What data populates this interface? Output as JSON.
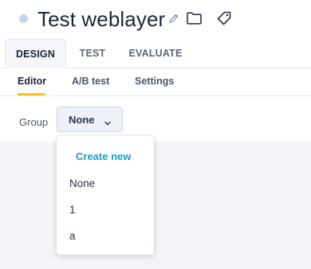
{
  "header": {
    "title": "Test weblayer",
    "status_color": "#c9d3ea",
    "icons": [
      "pencil-icon",
      "folder-icon",
      "tag-icon"
    ]
  },
  "main_tabs": [
    {
      "label": "DESIGN",
      "active": true
    },
    {
      "label": "TEST",
      "active": false
    },
    {
      "label": "EVALUATE",
      "active": false
    }
  ],
  "sub_tabs": [
    {
      "label": "Editor",
      "active": true
    },
    {
      "label": "A/B test",
      "active": false
    },
    {
      "label": "Settings",
      "active": false
    }
  ],
  "group": {
    "label": "Group",
    "selected": "None"
  },
  "dropdown": {
    "create_label": "Create new",
    "options": [
      "None",
      "1",
      "a"
    ]
  },
  "colors": {
    "accent": "#1a9cc3",
    "active_underline": "#f7c51e"
  }
}
